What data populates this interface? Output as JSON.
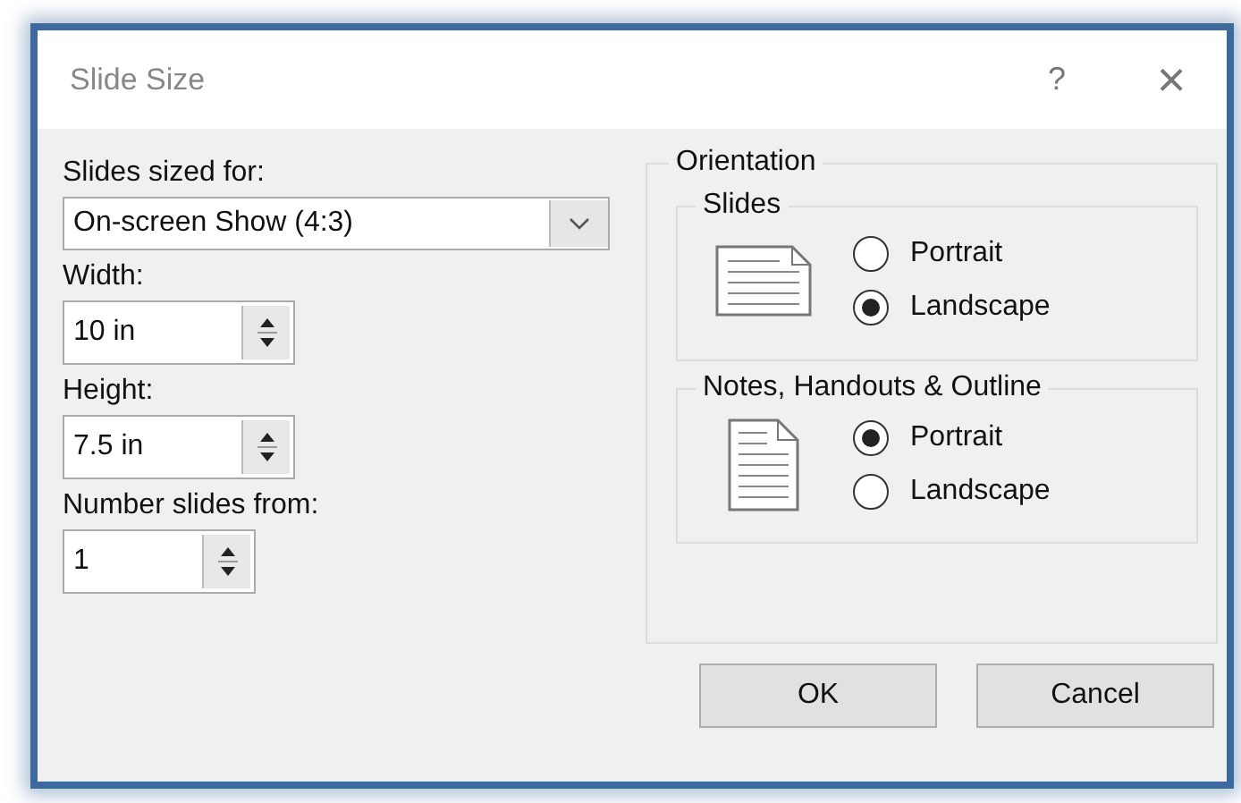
{
  "window": {
    "title": "Slide Size",
    "help": "?",
    "close": "×"
  },
  "slides_sized_for": {
    "label": "Slides sized for:",
    "value": "On-screen Show (4:3)"
  },
  "spinners": [
    {
      "label": "Width:",
      "value": "10 in"
    },
    {
      "label": "Height:",
      "value": "7.5 in"
    },
    {
      "label": "Number slides from:",
      "value": "1"
    }
  ],
  "orientation": {
    "title": "Orientation",
    "groups": [
      {
        "title": "Slides",
        "kind": "landscape",
        "options": [
          {
            "label": "Portrait",
            "selected": false
          },
          {
            "label": "Landscape",
            "selected": true
          }
        ]
      },
      {
        "title": "Notes, Handouts & Outline",
        "kind": "portrait",
        "options": [
          {
            "label": "Portrait",
            "selected": true
          },
          {
            "label": "Landscape",
            "selected": false
          }
        ]
      }
    ]
  },
  "buttons": [
    "OK",
    "Cancel"
  ]
}
